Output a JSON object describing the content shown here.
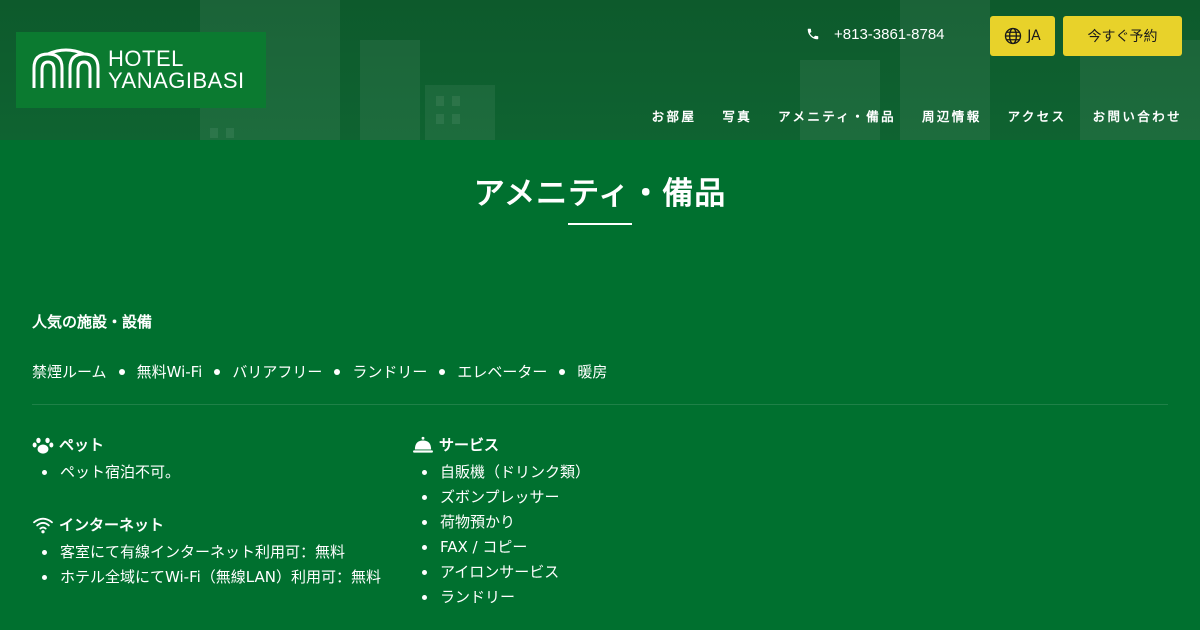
{
  "header": {
    "logo_line1": "HOTEL",
    "logo_line2": "YANAGIBASI",
    "phone": "+813-3861-8784",
    "lang_label": "JA",
    "book_label": "今すぐ予約",
    "nav": [
      "お部屋",
      "写真",
      "アメニティ・備品",
      "周辺情報",
      "アクセス",
      "お問い合わせ"
    ]
  },
  "page": {
    "title": "アメニティ・備品"
  },
  "popular": {
    "heading": "人気の施設・設備",
    "items": [
      "禁煙ルーム",
      "無料Wi-Fi",
      "バリアフリー",
      "ランドリー",
      "エレベーター",
      "暖房"
    ]
  },
  "groups": {
    "pet": {
      "icon": "paw-icon",
      "title": "ペット",
      "items": [
        "ペット宿泊不可。"
      ]
    },
    "internet": {
      "icon": "wifi-icon",
      "title": "インターネット",
      "items": [
        "客室にて有線インターネット利用可：無料",
        "ホテル全域にてWi-Fi（無線LAN）利用可：無料"
      ]
    },
    "service": {
      "icon": "service-bell-icon",
      "title": "サービス",
      "items": [
        "自販機（ドリンク類）",
        "ズボンプレッサー",
        "荷物預かり",
        "FAX / コピー",
        "アイロンサービス",
        "ランドリー"
      ]
    }
  },
  "colors": {
    "background": "#00702f",
    "accent": "#e8d22a",
    "logo_bg": "#0b7a30"
  }
}
